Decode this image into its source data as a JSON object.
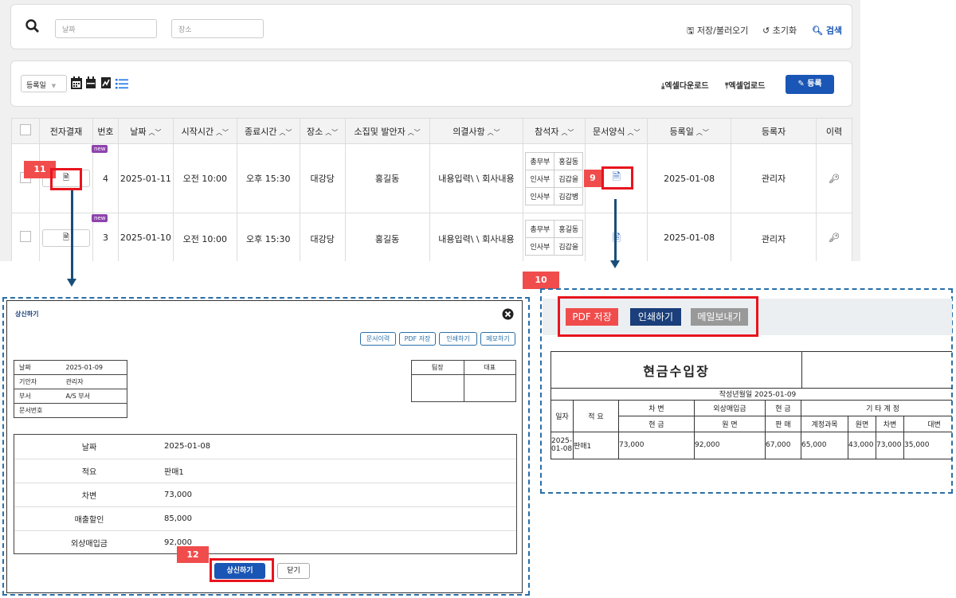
{
  "search": {
    "date_placeholder": "날짜",
    "place_placeholder": "장소",
    "save_load": "저장/불러오기",
    "reset": "초기화",
    "search": "검색"
  },
  "toolbar": {
    "sort_select": "등록일",
    "excel_download": "엑셀다운로드",
    "excel_upload": "엑셀업로드",
    "register": "등록"
  },
  "grid": {
    "headers": [
      "전자결재",
      "번호",
      "날짜",
      "시작시간",
      "종료시간",
      "장소",
      "소집및 발안자",
      "의결사항",
      "참석자",
      "문서양식",
      "등록일",
      "등록자",
      "이력"
    ],
    "rows": [
      {
        "new_badge": "new",
        "no": "4",
        "date": "2025-01-11",
        "start": "오전 10:00",
        "end": "오후 15:30",
        "place": "대강당",
        "convener": "홍길동",
        "resolution": "내용입력\\ \\ 회사내용",
        "attendees": [
          [
            "총무부",
            "홍길동"
          ],
          [
            "인사부",
            "김갑을"
          ],
          [
            "인사부",
            "김갑병"
          ]
        ],
        "reg_date": "2025-01-08",
        "registrant": "관리자"
      },
      {
        "new_badge": "new",
        "no": "3",
        "date": "2025-01-10",
        "start": "오전 10:00",
        "end": "오후 15:30",
        "place": "대강당",
        "convener": "홍길동",
        "resolution": "내용입력\\ \\ 회사내용",
        "attendees": [
          [
            "총무부",
            "홍길동"
          ],
          [
            "인사부",
            "김갑을"
          ]
        ],
        "reg_date": "2025-01-08",
        "registrant": "관리자"
      }
    ]
  },
  "callouts": {
    "n9": "9",
    "n10": "10",
    "n11": "11",
    "n12": "12"
  },
  "popup": {
    "title": "상신하기",
    "buttons": [
      "문서이력",
      "PDF 저장",
      "인쇄하기",
      "메모하기"
    ],
    "info": {
      "date_label": "날짜",
      "date_value": "2025-01-09",
      "drafter_label": "기안자",
      "drafter_value": "관리자",
      "dept_label": "부서",
      "dept_value": "A/S 부서",
      "docno_label": "문서번호"
    },
    "approvers": [
      "팀장",
      "대표"
    ],
    "details": [
      {
        "label": "날짜",
        "value": "2025-01-08"
      },
      {
        "label": "적요",
        "value": "판매1"
      },
      {
        "label": "차변",
        "value": "73,000"
      },
      {
        "label": "매출할인",
        "value": "85,000"
      },
      {
        "label": "외상매입금",
        "value": "92,000"
      }
    ],
    "submit": "상신하기",
    "close": "닫기"
  },
  "preview": {
    "pdf": "PDF 저장",
    "print": "인쇄하기",
    "mail": "메일보내기",
    "doc_title": "현금수입장",
    "written_date": "작성년월일 2025-01-09",
    "h_debit": "차 변",
    "h_credit_purchase": "외상매입금",
    "h_cash": "현 금",
    "h_other": "기 타 계 정",
    "h_date": "일자",
    "h_desc": "적 요",
    "h_cash2": "현 금",
    "h_principal": "원 면",
    "h_sale": "판 매",
    "h_account": "계정과목",
    "h_principal2": "원면",
    "h_debit2": "차변",
    "h_credit2": "대변",
    "row": {
      "date": "2025-01-08",
      "desc": "판매1",
      "v1": "73,000",
      "v2": "92,000",
      "v3": "67,000",
      "v4": "65,000",
      "v5": "43,000",
      "v6": "73,000",
      "v7": "35,000"
    }
  },
  "colors": {
    "accent_blue": "#1a56b5",
    "callout_red": "#f04c4c",
    "new_badge": "#8e44ad"
  }
}
